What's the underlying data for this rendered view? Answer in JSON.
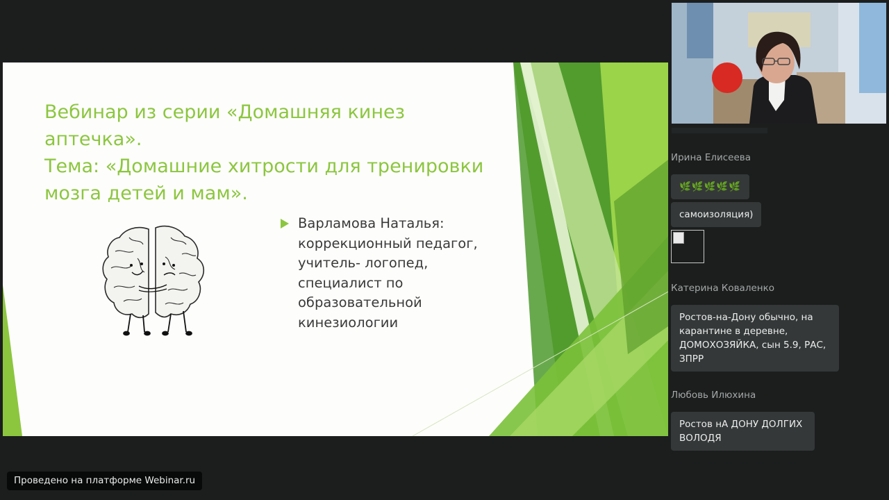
{
  "slide": {
    "title_lines": [
      "Вебинар из серии «Домашняя кинез",
      "аптечка».",
      "Тема: «Домашние хитрости для тренировки",
      "мозга детей и мам»."
    ],
    "bullet_lines": [
      "Варламова Наталья:",
      "коррекционный педагог,",
      "учитель- логопед,",
      "специалист по",
      "образовательной",
      "кинезиологии"
    ],
    "accent_color": "#8cc63f",
    "illustration": "brain-halves-drawing"
  },
  "video": {
    "description": "presenter-webcam"
  },
  "chat": {
    "messages": [
      {
        "author": "Ирина Елисеева",
        "bubbles": [
          {
            "type": "emoji",
            "text": "🌿🌿🌿🌿🌿"
          },
          {
            "type": "text",
            "text": "самоизоляция)"
          },
          {
            "type": "image",
            "icon": "broken-image-icon"
          }
        ]
      },
      {
        "author": "Катерина Коваленко",
        "lines": [
          "Ростов-на-Дону обычно, на",
          "карантине в деревне,",
          "ДОМОХОЗЯЙКА,  сын 5.9, РАС,",
          "ЗПРР"
        ]
      },
      {
        "author": "Любовь Илюхина",
        "lines": [
          "Ростов нА ДОНУ ДОЛГИХ",
          "ВОЛОДЯ"
        ]
      }
    ]
  },
  "footer": {
    "label": "Проведено на платформе Webinar.ru"
  }
}
